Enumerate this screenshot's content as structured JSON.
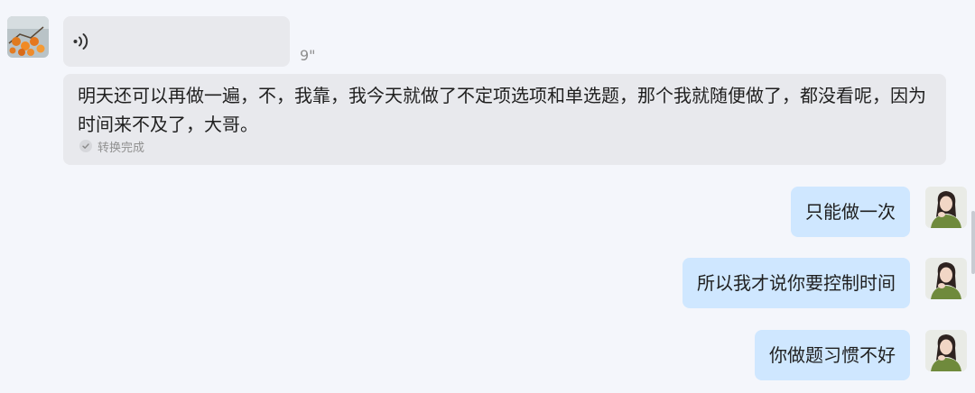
{
  "messages": {
    "voice": {
      "duration": "9\"",
      "transcript": "明天还可以再做一遍，不，我靠，我今天就做了不定项选项和单选题，那个我就随便做了，都没看呢，因为时间来不及了，大哥。",
      "status": "转换完成"
    },
    "outgoing": [
      {
        "text": "只能做一次"
      },
      {
        "text": "所以我才说你要控制时间"
      },
      {
        "text": "你做题习惯不好"
      }
    ]
  },
  "colors": {
    "background": "#f4f6fb",
    "incoming_bubble": "#e8e9ed",
    "outgoing_bubble": "#cfe7ff"
  },
  "icons": {
    "voice": "voice-wave-icon",
    "status": "check-icon"
  }
}
